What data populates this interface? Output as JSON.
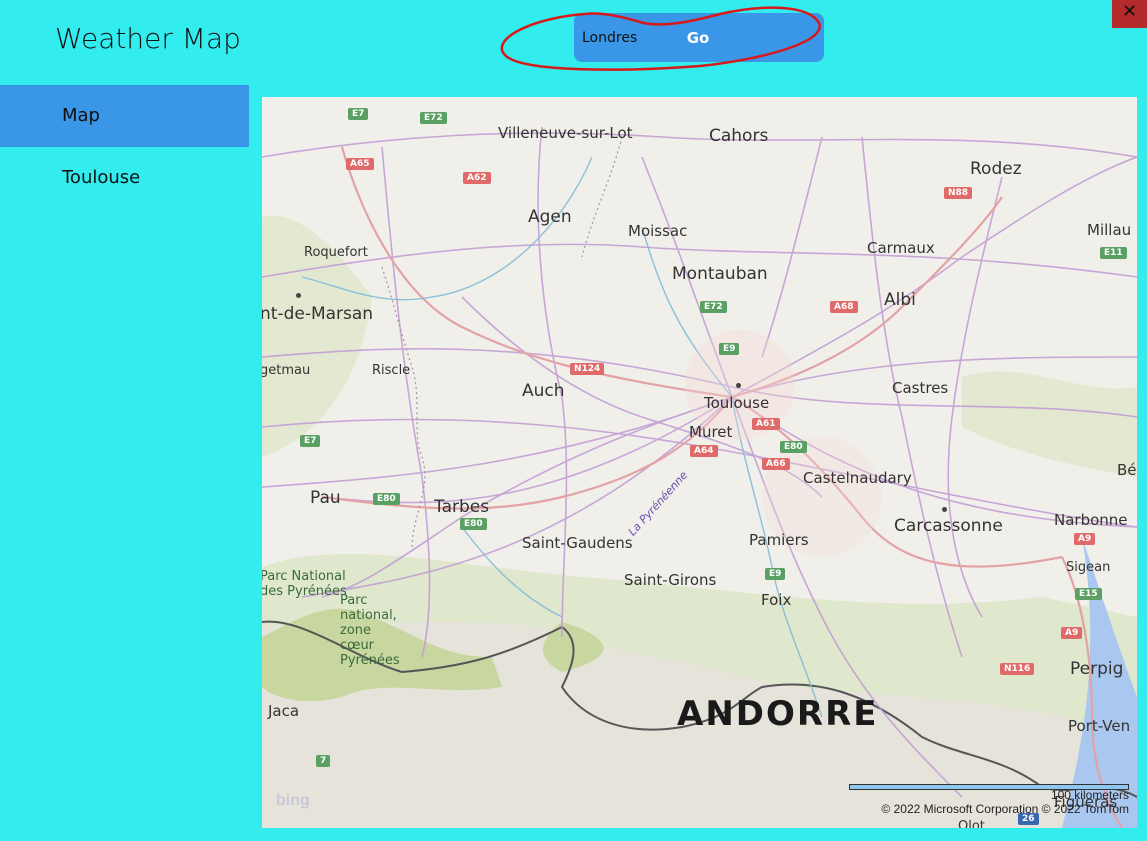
{
  "app": {
    "title": "Weather Map",
    "close_label": "✕"
  },
  "search": {
    "value": "Londres",
    "go_label": "Go"
  },
  "sidebar": {
    "items": [
      {
        "label": "Map"
      },
      {
        "label": "Toulouse"
      }
    ]
  },
  "map": {
    "cities": [
      "Villeneuve-sur-Lot",
      "Cahors",
      "Rodez",
      "Agen",
      "Moissac",
      "Millau",
      "Roquefort",
      "Carmaux",
      "Montauban",
      "Albi",
      "nt-de-Marsan",
      "getmau",
      "Riscle",
      "Auch",
      "Toulouse",
      "Castres",
      "Muret",
      "Pau",
      "Tarbes",
      "Castelnaudary",
      "Bé",
      "Carcassonne",
      "Narbonne",
      "Saint-Gaudens",
      "Pamiers",
      "Sigean",
      "Saint-Girons",
      "Foix",
      "Parc National des Pyrénées",
      "Parc national, zone cœur Pyrénées",
      "Perpig",
      "Jaca",
      "Port-Ven",
      "Figueras",
      "Olot"
    ],
    "country": "ANDORRE",
    "river": "La Pyrénéenne",
    "roads": [
      "E7",
      "E72",
      "A65",
      "A62",
      "N88",
      "E11",
      "E72",
      "A68",
      "E9",
      "N124",
      "A61",
      "E80",
      "A64",
      "A66",
      "E7",
      "E80",
      "E80",
      "A9",
      "E9",
      "E15",
      "A9",
      "N116",
      "7",
      "26"
    ],
    "scale": "100 kilometers",
    "copyright": "© 2022 Microsoft Corporation   © 2022 TomTom",
    "logo": "bing"
  }
}
